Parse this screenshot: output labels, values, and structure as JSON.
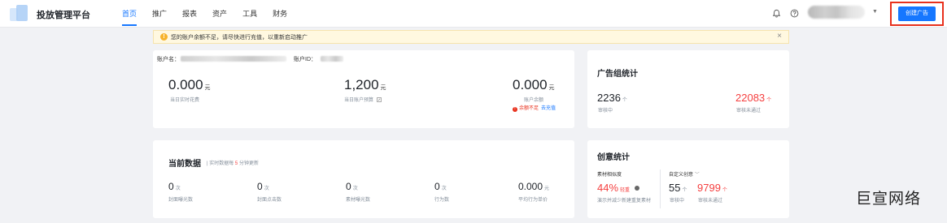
{
  "header": {
    "brand": "投放管理平台",
    "nav": [
      "首页",
      "推广",
      "报表",
      "资产",
      "工具",
      "财务"
    ],
    "active_nav": "首页",
    "create_button": "创建广告"
  },
  "notice": {
    "message": "您的账户余额不足，请尽快进行充值，以重新启动推广",
    "close": "×"
  },
  "account": {
    "name_label": "账户名：",
    "id_label": "账户ID：",
    "metrics": [
      {
        "value": "0.000",
        "unit": "元",
        "label": "当日实时花费"
      },
      {
        "value": "1,200",
        "unit": "元",
        "label": "当日账户预算"
      },
      {
        "value": "0.000",
        "unit": "元",
        "label": "账户余额"
      }
    ],
    "balance_warning": "余额不足",
    "recharge": "去充值"
  },
  "adgroup": {
    "title": "广告组统计",
    "left": {
      "value": "2236",
      "unit": "个",
      "label": "审核中"
    },
    "right": {
      "value": "22083",
      "unit": "个",
      "label": "审核未通过"
    }
  },
  "current": {
    "title": "当前数据",
    "hint_prefix": "实时数据每",
    "hint_num": "5",
    "hint_suffix": "分钟更新",
    "metrics": [
      {
        "value": "0",
        "unit": "次",
        "label": "封面曝光数"
      },
      {
        "value": "0",
        "unit": "次",
        "label": "封面点击数"
      },
      {
        "value": "0",
        "unit": "次",
        "label": "素材曝光数"
      },
      {
        "value": "0",
        "unit": "次",
        "label": "行为数"
      },
      {
        "value": "0.000",
        "unit": "元",
        "label": "平均行为单价"
      }
    ]
  },
  "creative": {
    "title": "创意统计",
    "similar_label": "素材相似度",
    "similar_value": "44%",
    "similar_tag": "轻重",
    "similar_desc": "演示并减少新建重复素材",
    "custom_label": "自定义创意",
    "left": {
      "value": "55",
      "unit": "个",
      "label": "审核中"
    },
    "right": {
      "value": "9799",
      "unit": "个",
      "label": "审核未通过"
    }
  },
  "watermark": "巨宣网络",
  "colors": {
    "accent": "#1677ff",
    "danger": "#f53f3f",
    "warning": "#f7b32a",
    "highlight": "#e8301c"
  }
}
